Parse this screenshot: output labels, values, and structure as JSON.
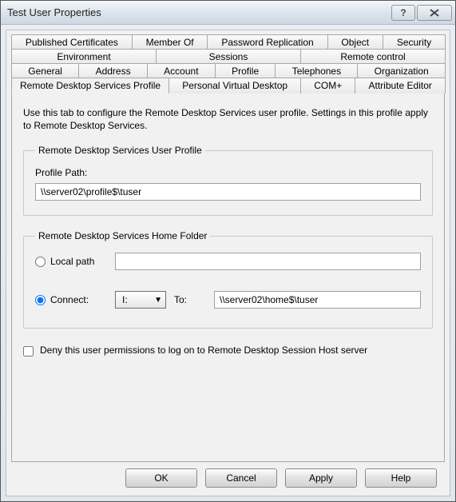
{
  "window": {
    "title": "Test User Properties"
  },
  "tabs": {
    "row1": [
      "Published Certificates",
      "Member Of",
      "Password Replication",
      "Object",
      "Security"
    ],
    "row2": [
      "Environment",
      "Sessions",
      "Remote control"
    ],
    "row3": [
      "General",
      "Address",
      "Account",
      "Profile",
      "Telephones",
      "Organization"
    ],
    "row4": [
      "Remote Desktop Services Profile",
      "Personal Virtual Desktop",
      "COM+",
      "Attribute Editor"
    ],
    "active": "Remote Desktop Services Profile"
  },
  "content": {
    "description": "Use this tab to configure the Remote Desktop Services user profile. Settings in this profile apply to Remote Desktop Services."
  },
  "profile_group": {
    "legend": "Remote Desktop Services User Profile",
    "path_label": "Profile Path:",
    "path_value": "\\\\server02\\profile$\\tuser"
  },
  "home_group": {
    "legend": "Remote Desktop Services Home Folder",
    "local_label": "Local path",
    "local_selected": false,
    "local_value": "",
    "connect_label": "Connect:",
    "connect_selected": true,
    "drive_letter": "I:",
    "to_label": "To:",
    "to_value": "\\\\server02\\home$\\tuser"
  },
  "deny": {
    "label": "Deny this user permissions to log on to Remote Desktop Session Host server",
    "checked": false
  },
  "buttons": {
    "ok": "OK",
    "cancel": "Cancel",
    "apply": "Apply",
    "help": "Help"
  }
}
